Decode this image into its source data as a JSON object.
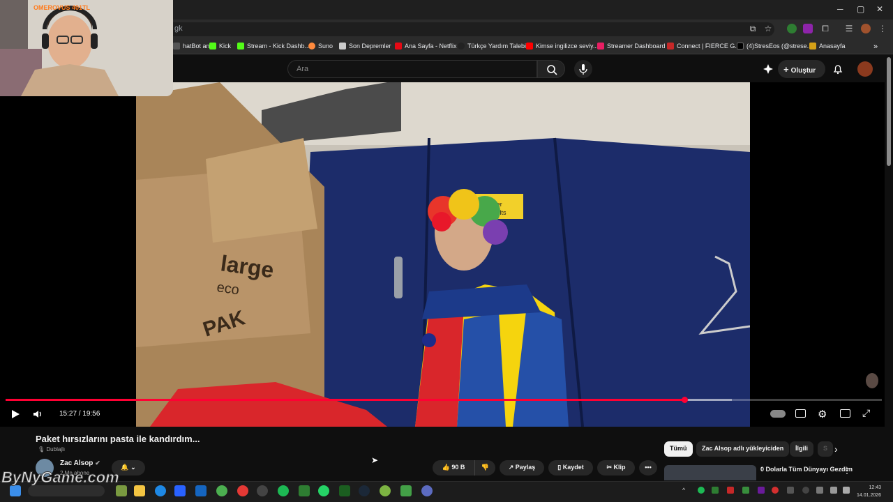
{
  "browser": {
    "url_fragment": "gk",
    "window_controls": [
      "─",
      "▢",
      "✕"
    ]
  },
  "bookmarks": [
    {
      "label": "hatBot an...",
      "color": "#555555"
    },
    {
      "label": "Kick",
      "color": "#53fc18"
    },
    {
      "label": "Stream - Kick Dashb...",
      "color": "#53fc18"
    },
    {
      "label": "Suno",
      "color": "#ff8a3d"
    },
    {
      "label": "Son Depremler",
      "color": "#cccccc"
    },
    {
      "label": "Ana Sayfa - Netflix",
      "color": "#e50914"
    },
    {
      "label": "Türkçe Yardım Talebi",
      "color": "#222222"
    },
    {
      "label": "Kimse ingilizce seviy...",
      "color": "#ff0000"
    },
    {
      "label": "Streamer Dashboard",
      "color": "#e91e63"
    },
    {
      "label": "Connect | FIERCE G...",
      "color": "#c62828"
    },
    {
      "label": "(4)StresEos (@strese...",
      "color": "#000000"
    },
    {
      "label": "Anasayfa",
      "color": "#d4a017"
    }
  ],
  "youtube": {
    "search_placeholder": "Ara",
    "create_label": "Oluştur"
  },
  "webcam": {
    "overlay_text": "OMEROVUS 401TL"
  },
  "player": {
    "timecode": "15:27 / 19:56",
    "progress_fraction": 0.7744,
    "buffered_fraction": 0.8288
  },
  "video": {
    "title": "Paket hırsızlarını pasta ile kandırdım...",
    "dub_label": "Dublajlı",
    "channel_name": "Zac Alsop",
    "subscribers": "2 Mn abone",
    "likes": "90 B",
    "share_label": "Paylaş",
    "save_label": "Kaydet",
    "clip_label": "Klip",
    "more_label": "•••"
  },
  "filter_chips": [
    "Tümü",
    "Zac Alsop adlı yükleyiciden",
    "İlgili",
    "S"
  ],
  "recommendation": {
    "title": "0 Dolarla Tüm Dünyayı Gezdim"
  },
  "watermark": "ByNyGame.com",
  "clock": {
    "time": "12:43",
    "date": "14.01.2026"
  }
}
